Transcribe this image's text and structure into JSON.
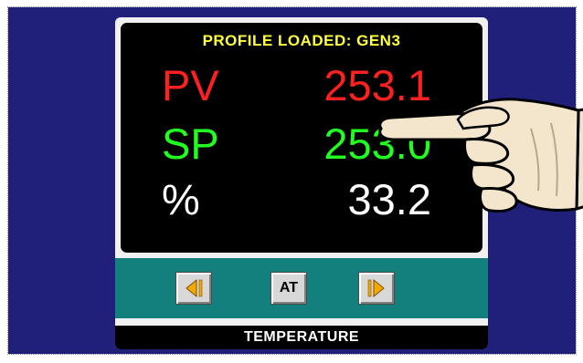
{
  "header": {
    "profile_status": "PROFILE LOADED: GEN3"
  },
  "readouts": [
    {
      "label": "PV",
      "value": "253.1",
      "color": "#ff2020"
    },
    {
      "label": "SP",
      "value": "253.0",
      "color": "#20ff20"
    },
    {
      "label": "%",
      "value": "33.2",
      "color": "#ffffff"
    }
  ],
  "controls": {
    "prev_icon": "prev-page-icon",
    "at_label": "AT",
    "next_icon": "next-page-icon"
  },
  "footer": {
    "title": "TEMPERATURE"
  },
  "colors": {
    "background": "#20207a",
    "panel": "#f0f0f0",
    "control_bar": "#13807e",
    "accent_yellow": "#ffff3c",
    "arrow_orange": "#f5a800"
  },
  "overlay": {
    "icon": "pointing-hand-icon"
  }
}
